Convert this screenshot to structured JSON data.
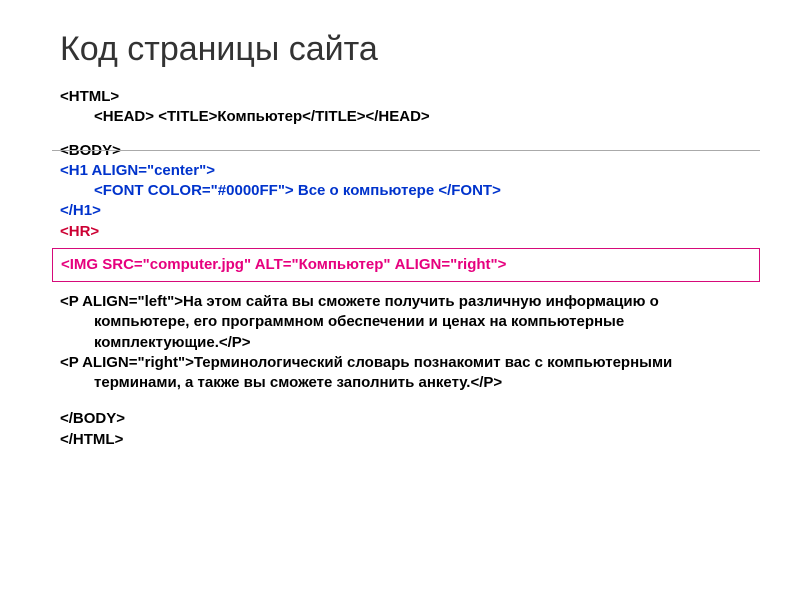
{
  "title": "Код страницы сайта",
  "code": {
    "l1": "<HTML>",
    "l2": "<HEAD> <TITLE>Компьютер</TITLE></HEAD>",
    "l3": "<BODY>",
    "l4": "<H1 ALIGN=\"center\">",
    "l5a": "<FONT COLOR=\"#0000FF\">",
    "l5b": " Все о компьютере ",
    "l5c": "</FONT>",
    "l6": "</H1>",
    "l7": "<HR>",
    "l8": "<IMG SRC=\"computer.jpg\" ALT=\"Компьютер\" ALIGN=\"right\">",
    "l9a": "<P ALIGN=\"left\">",
    "l9b": "На этом сайта вы сможете получить различную информацию  о компьютере, его программном обеспечении и ценах на компьютерные комплектующие.",
    "l9c": "</P>",
    "l10a": "<P ALIGN=\"right\">",
    "l10b": "Терминологический словарь познакомит вас с компьютерными терминами, а также вы сможете заполнить анкету.",
    "l10c": "</P>",
    "l11": "</BODY>",
    "l12": "</HTML>"
  }
}
